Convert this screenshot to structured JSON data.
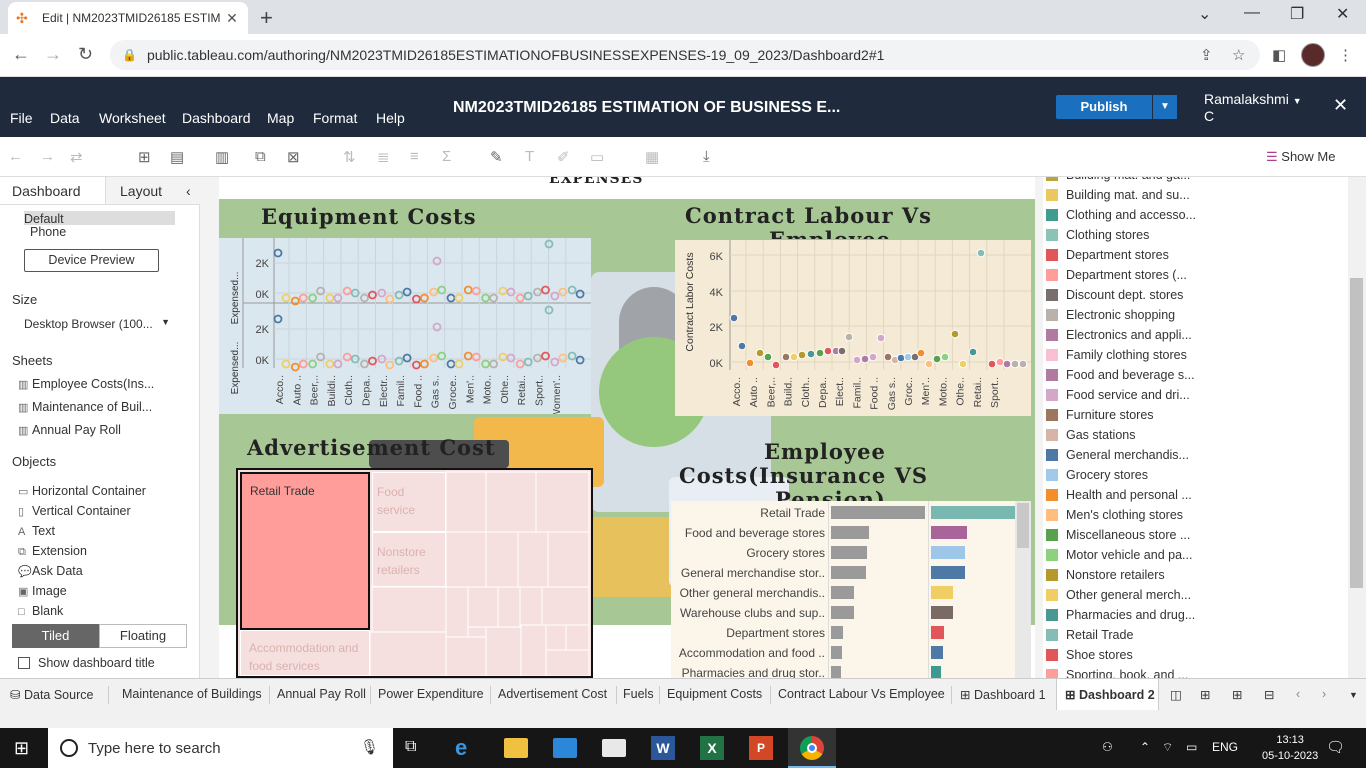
{
  "browser": {
    "tab_title": "Edit | NM2023TMID26185 ESTIM",
    "url": "public.tableau.com/authoring/NM2023TMID26185ESTIMATIONOFBUSINESSEXPENSES-19_09_2023/Dashboard2#1"
  },
  "app": {
    "menus": [
      "File",
      "Data",
      "Worksheet",
      "Dashboard",
      "Map",
      "Format",
      "Help"
    ],
    "workbook_title": "NM2023TMID26185 ESTIMATION OF BUSINESS E...",
    "publish_label": "Publish",
    "user_line1": "Ramalakshmi",
    "user_line2": "C",
    "show_me": "Show Me"
  },
  "left_panel": {
    "tabs": [
      "Dashboard",
      "Layout"
    ],
    "device_default": "Default",
    "device_phone": "Phone",
    "device_preview": "Device Preview",
    "size_heading": "Size",
    "size_value": "Desktop Browser (100...",
    "sheets_heading": "Sheets",
    "sheets": [
      "Employee Costs(Ins...",
      "Maintenance of Buil...",
      "Annual Pay Roll"
    ],
    "objects_heading": "Objects",
    "objects": [
      "Horizontal Container",
      "Vertical Container",
      "Text",
      "Extension",
      "Ask Data",
      "Image",
      "Blank"
    ],
    "tiled": "Tiled",
    "floating": "Floating",
    "show_title": "Show dashboard title"
  },
  "dashboard": {
    "top_title_fragment": "EXPENSES",
    "equipment_title": "Equipment Costs",
    "contract_title_line1": "Contract Labour Vs",
    "contract_title_line2": "Employee",
    "advert_title": "Advertisement Cost",
    "employee_title_line1": "Employee",
    "employee_title_line2": "Costs(Insurance VS",
    "employee_title_line3": "Pension)"
  },
  "equipment_chart": {
    "row_labels": [
      "Expensed...",
      "Expensed..."
    ],
    "y_ticks_top": [
      "2K",
      "0K"
    ],
    "y_ticks_bottom": [
      "2K",
      "0K"
    ],
    "x_labels": [
      "Acco..",
      "Auto ..",
      "Beer,..",
      "Buildi..",
      "Cloth..",
      "Depa..",
      "Electr..",
      "Famil..",
      "Food ..",
      "Gas s..",
      "Groce..",
      "Men'..",
      "Moto..",
      "Othe..",
      "Retai..",
      "Sport..",
      "Women'.."
    ]
  },
  "contract_chart": {
    "y_label": "Contract Labor Costs",
    "y_ticks": [
      "6K",
      "4K",
      "2K",
      "0K"
    ],
    "x_labels": [
      "Acco..",
      "Auto ..",
      "Beer,..",
      "Build..",
      "Cloth..",
      "Depa..",
      "Elect..",
      "Famil..",
      "Food ..",
      "Gas s..",
      "Groc..",
      "Men'..",
      "Moto..",
      "Othe..",
      "Retai..",
      "Sport.."
    ]
  },
  "treemap": {
    "labels": [
      "Retail Trade",
      "Food service",
      "Nonstore retailers",
      "Accommodation and food services"
    ]
  },
  "employee_chart": {
    "rows": [
      {
        "label": "Retail Trade",
        "a": 1.0,
        "b": 1.0,
        "color": "#79b8b1"
      },
      {
        "label": "Food and beverage stores",
        "a": 0.4,
        "b": 0.43,
        "color": "#a9649a"
      },
      {
        "label": "Grocery stores",
        "a": 0.38,
        "b": 0.41,
        "color": "#9ec6e8"
      },
      {
        "label": "General merchandise stor..",
        "a": 0.37,
        "b": 0.41,
        "color": "#4e79a7"
      },
      {
        "label": "Other general merchandis..",
        "a": 0.24,
        "b": 0.26,
        "color": "#f1ce63"
      },
      {
        "label": "Warehouse clubs and sup..",
        "a": 0.24,
        "b": 0.26,
        "color": "#7a6a66"
      },
      {
        "label": "Department stores",
        "a": 0.13,
        "b": 0.15,
        "color": "#e15759"
      },
      {
        "label": "Accommodation and food ..",
        "a": 0.12,
        "b": 0.14,
        "color": "#4e79a7"
      },
      {
        "label": "Pharmacies and drug stor..",
        "a": 0.11,
        "b": 0.12,
        "color": "#3d9a8f"
      }
    ]
  },
  "legend": [
    {
      "label": "Building mat. and ga...",
      "color": "#b7a63c"
    },
    {
      "label": "Building mat. and su...",
      "color": "#e9c85f"
    },
    {
      "label": "Clothing and accesso...",
      "color": "#3f9c8f"
    },
    {
      "label": "Clothing stores",
      "color": "#8cc3b7"
    },
    {
      "label": "Department stores",
      "color": "#e15759"
    },
    {
      "label": "Department stores (...",
      "color": "#ff9d9a"
    },
    {
      "label": "Discount dept. stores",
      "color": "#79706e"
    },
    {
      "label": "Electronic shopping",
      "color": "#bab0ac"
    },
    {
      "label": "Electronics and appli...",
      "color": "#b07aa1"
    },
    {
      "label": "Family clothing stores",
      "color": "#fabfd2"
    },
    {
      "label": "Food and beverage s...",
      "color": "#b07aa1"
    },
    {
      "label": "Food service and dri...",
      "color": "#d4a6c8"
    },
    {
      "label": "Furniture stores",
      "color": "#9d7660"
    },
    {
      "label": "Gas stations",
      "color": "#d7b5a6"
    },
    {
      "label": "General merchandis...",
      "color": "#4e79a7"
    },
    {
      "label": "Grocery stores",
      "color": "#a0cbe8"
    },
    {
      "label": "Health and personal ...",
      "color": "#f28e2b"
    },
    {
      "label": "Men's clothing stores",
      "color": "#ffbe7d"
    },
    {
      "label": "Miscellaneous store ...",
      "color": "#59a14f"
    },
    {
      "label": "Motor vehicle and pa...",
      "color": "#8cd17d"
    },
    {
      "label": "Nonstore retailers",
      "color": "#b6992d"
    },
    {
      "label": "Other general merch...",
      "color": "#f1ce63"
    },
    {
      "label": "Pharmacies and drug...",
      "color": "#499894"
    },
    {
      "label": "Retail Trade",
      "color": "#86bcb6"
    },
    {
      "label": "Shoe stores",
      "color": "#e15759"
    },
    {
      "label": "Sporting, book, and ...",
      "color": "#ff9d9a"
    }
  ],
  "sheet_tabs": [
    "Data Source",
    "Maintenance of Buildings",
    "Annual Pay Roll",
    "Power Expenditure",
    "Advertisement Cost",
    "Fuels",
    "Equipment Costs",
    "Contract Labour Vs Employee",
    "Dashboard 1",
    "Dashboard 2"
  ],
  "taskbar": {
    "search_placeholder": "Type here to search",
    "time": "13:13",
    "date": "05-10-2023",
    "lang": "ENG"
  }
}
